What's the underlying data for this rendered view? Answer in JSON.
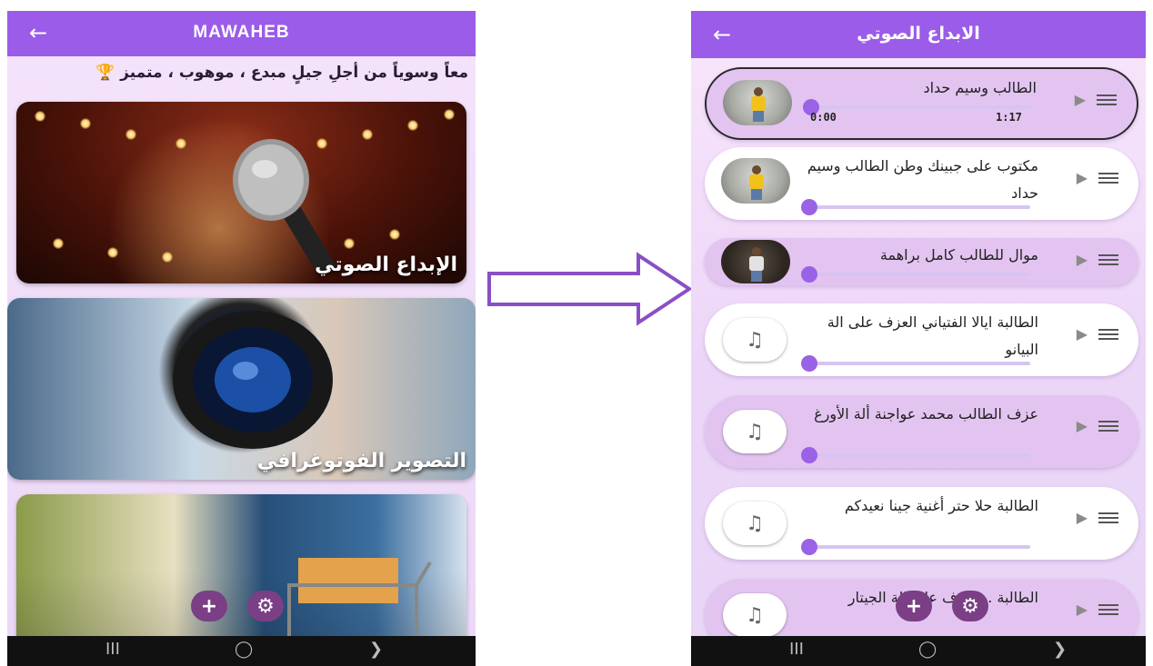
{
  "left_screen": {
    "app_title": "MAWAHEB",
    "back_icon": "arrow-left-icon",
    "tagline": "معاً وسوياً من أجلِ جيلٍ مبدع ، موهوب ، متميز",
    "tagline_icon": "trophy-icon",
    "categories": [
      {
        "label": "الإبداع الصوتي",
        "image": "microphone-stage-photo"
      },
      {
        "label": "التصوير الفوتوغرافي",
        "image": "camera-lens-photo"
      },
      {
        "label": "",
        "image": "shopping-cart-laptop-photo"
      }
    ],
    "fab_add": "+",
    "fab_settings": "⚙",
    "nav": {
      "recents": "III",
      "home": "◯",
      "back": "❯"
    }
  },
  "arrow": {
    "icon": "right-arrow-outline"
  },
  "right_screen": {
    "title": "الابداع الصوتي",
    "back_icon": "arrow-left-icon",
    "tracks": [
      {
        "title": "الطالب وسيم حداد",
        "thumb": "student-photo",
        "time_current": "0:00",
        "time_total": "1:17",
        "style": "outlined-purple"
      },
      {
        "title": "مكتوب على جبينك وطن الطالب وسيم حداد",
        "thumb": "student-photo",
        "style": "white"
      },
      {
        "title": "موال للطالب كامل براهمة",
        "thumb": "student-photo-2",
        "style": "purple-flat"
      },
      {
        "title": "الطالبة ايالا الفتياني العزف على الة البيانو",
        "thumb": "music-note-icon",
        "style": "white"
      },
      {
        "title": "عزف الطالب محمد عواجنة ألة الأورغ",
        "thumb": "music-note-icon",
        "style": "purple"
      },
      {
        "title": "الطالبة حلا حتر أغنية جينا نعيدكم",
        "thumb": "music-note-icon",
        "style": "white"
      },
      {
        "title": "الطالبة ... عزف على الة الجيتار",
        "thumb": "music-note-icon",
        "style": "purple"
      }
    ],
    "play_icon": "▶",
    "note_icon": "♫",
    "fab_add": "+",
    "fab_settings": "⚙",
    "nav": {
      "recents": "III",
      "home": "◯",
      "back": "❯"
    }
  },
  "colors": {
    "appbar": "#9a5ce9",
    "fab": "#7a3f84",
    "slider": "#9a62e6",
    "track_purple": "#e3c4f1"
  }
}
